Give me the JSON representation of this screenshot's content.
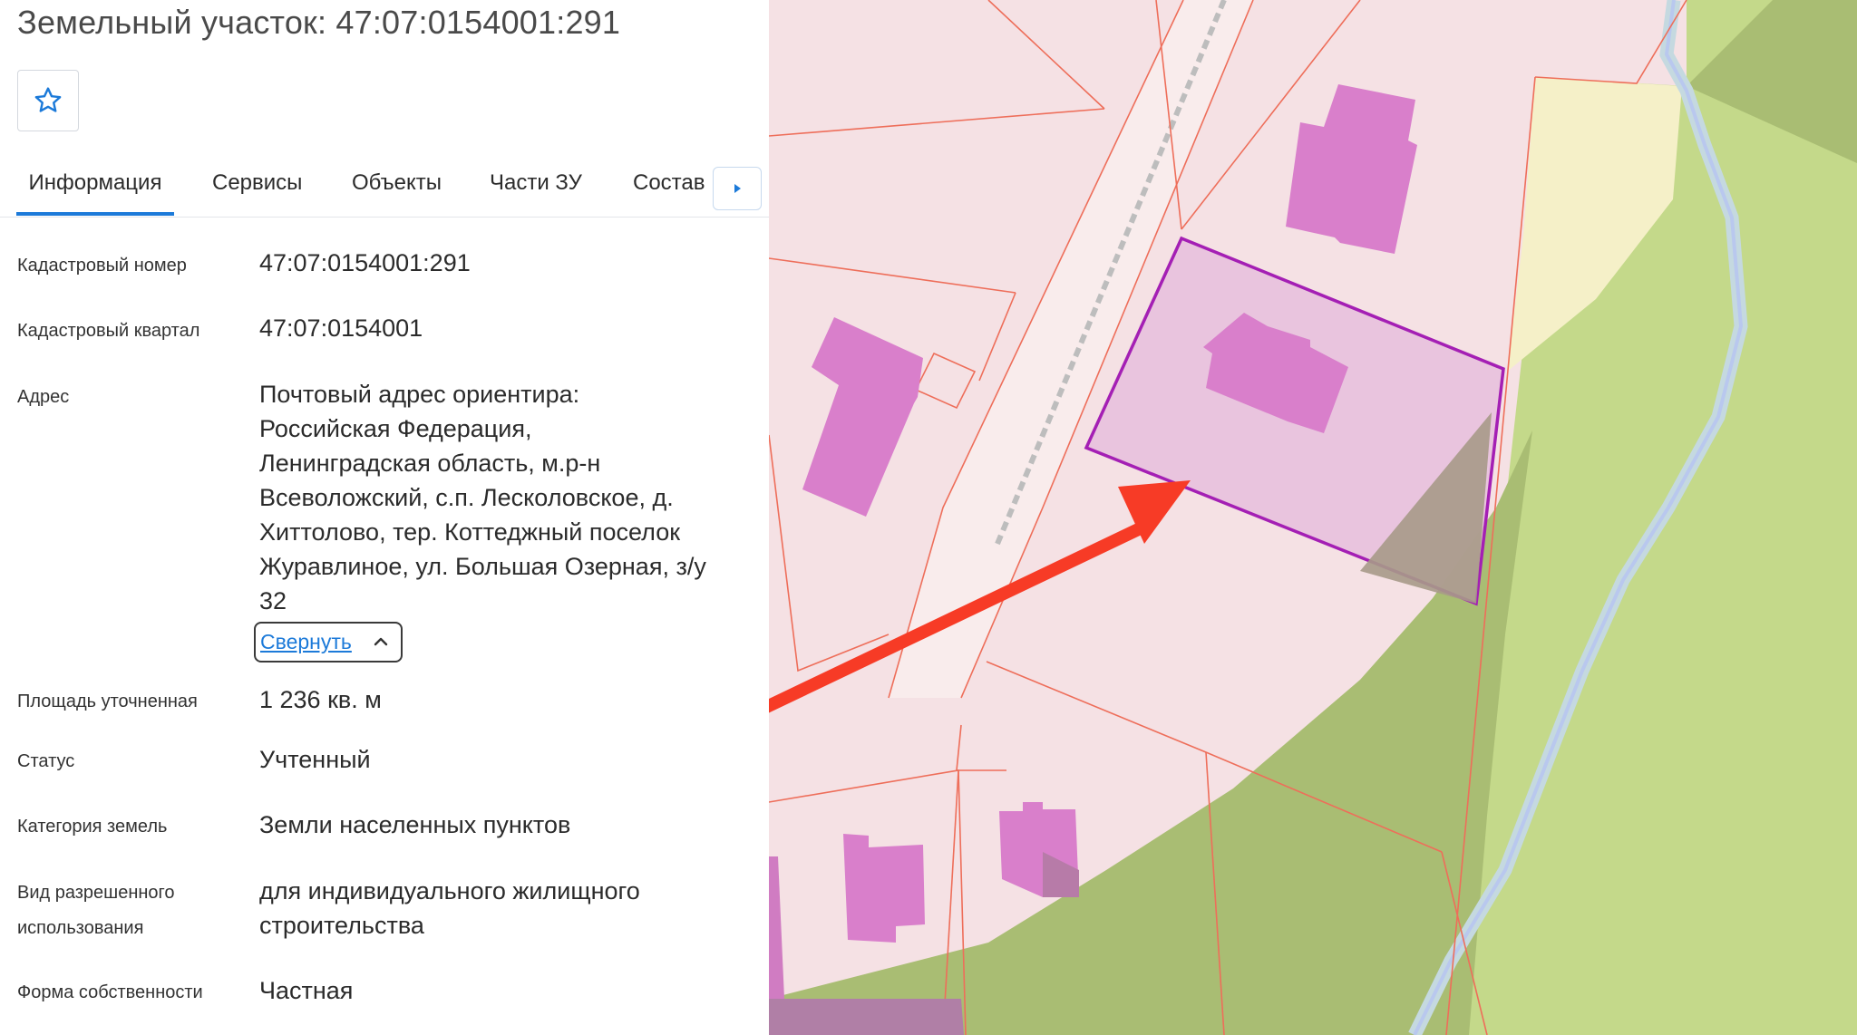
{
  "header": {
    "title": "Земельный участок: 47:07:0154001:291",
    "favorite_icon": "star-outline-icon"
  },
  "tabs": [
    {
      "label": "Информация",
      "active": true
    },
    {
      "label": "Сервисы"
    },
    {
      "label": "Объекты"
    },
    {
      "label": "Части ЗУ"
    },
    {
      "label": "Состав"
    }
  ],
  "tabs_next_icon": "caret-right-icon",
  "fields": {
    "cadastral_number": {
      "label": "Кадастровый номер",
      "value": "47:07:0154001:291"
    },
    "cadastral_quarter": {
      "label": "Кадастровый квартал",
      "value": "47:07:0154001"
    },
    "address": {
      "label": "Адрес",
      "lines": [
        "Почтовый адрес ориентира:",
        "Российская Федерация,",
        "Ленинградская область, м.р-н",
        "Всеволожский, с.п. Лесколовское, д.",
        "Хиттолово, тер. Коттеджный поселок",
        "Журавлиное, ул. Большая Озерная, з/у",
        "32"
      ],
      "collapse_label": "Свернуть"
    },
    "area": {
      "label": "Площадь уточненная",
      "value": "1 236 кв. м"
    },
    "status": {
      "label": "Статус",
      "value": "Учтенный"
    },
    "land_category": {
      "label": "Категория земель",
      "value": "Земли населенных пунктов"
    },
    "permitted_use": {
      "label_lines": [
        "Вид разрешенного",
        "использования"
      ],
      "value_lines": [
        "для индивидуального жилищного",
        "строительства"
      ]
    },
    "ownership": {
      "label": "Форма собственности",
      "value": "Частная"
    }
  },
  "map": {
    "parcel_fill": "#f5e1e4",
    "forest": "#a9bd73",
    "meadow": "#c4d98a",
    "building": "#d97fcb",
    "selected_outline": "#a41fb4",
    "arrow": "#f73b26",
    "boundary": "#ee6e5a"
  }
}
